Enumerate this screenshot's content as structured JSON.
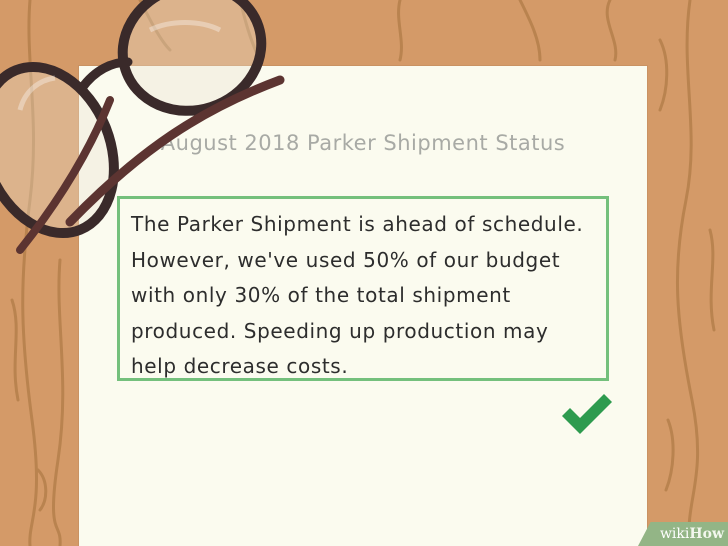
{
  "document": {
    "title": "August 2018 Parker Shipment Status",
    "body": "The Parker Shipment is ahead of schedule. However, we've used 50% of our budget with only 30% of the total shipment produced. Speeding up production may help decrease costs."
  },
  "icons": {
    "checkmark": "checkmark-icon",
    "glasses": "eyeglasses-icon"
  },
  "watermark": {
    "wiki": "wiki",
    "how": "How"
  },
  "colors": {
    "wood": "#d49a68",
    "wood_grain": "#b9834f",
    "paper": "#fbfbef",
    "memo_border": "#74c07c",
    "checkmark": "#2e9b4f",
    "title_text": "#a8aaa5",
    "glasses_frame": "#3a2a2a"
  }
}
